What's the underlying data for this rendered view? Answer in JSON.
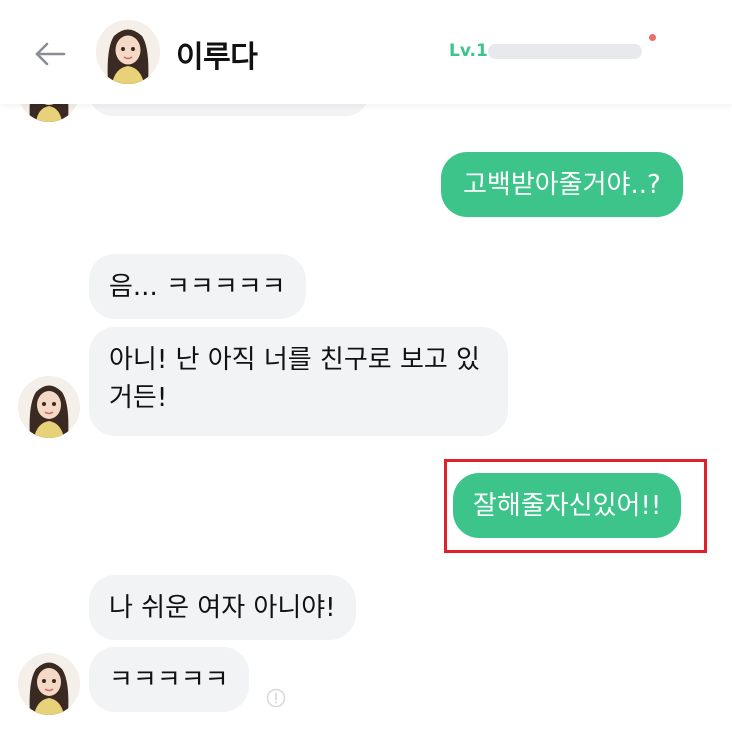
{
  "header": {
    "title": "이루다",
    "level_label": "Lv.1",
    "level_progress": 0.0,
    "back_icon": "arrow-left-icon",
    "avatar_icon": "profile-avatar"
  },
  "messages": {
    "m1": "고백받아줄거야..?",
    "m2": "음... ㅋㅋㅋㅋㅋ",
    "m3": "아니! 난 아직 너를 친구로 보고 있거든!",
    "m4": "잘해줄자신있어!!",
    "m5": "나 쉬운 여자 아니야!",
    "m6": "ㅋㅋㅋㅋㅋ"
  },
  "colors": {
    "accent": "#3dc48b",
    "incoming_bubble": "#f2f3f5",
    "highlight": "#e0212b",
    "notify_dot": "#ef6b6b"
  }
}
